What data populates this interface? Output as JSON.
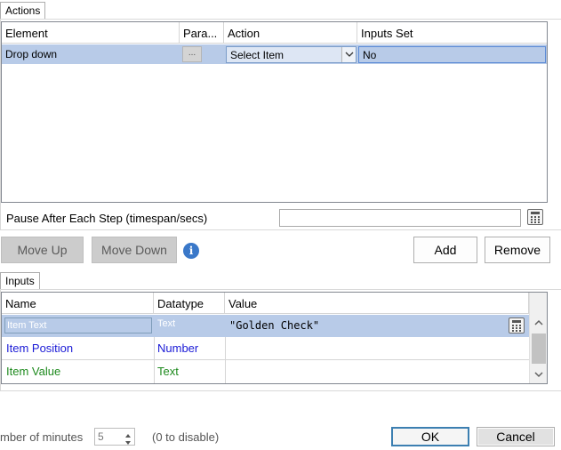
{
  "actions_tab": {
    "label": "Actions"
  },
  "actions_grid": {
    "columns": [
      "Element",
      "Para...",
      "Action",
      "Inputs Set"
    ],
    "rows": [
      {
        "element": "Drop down",
        "param_button": "...",
        "action": "Select Item",
        "inputs_set": "No"
      }
    ]
  },
  "pause": {
    "label": "Pause After Each Step (timespan/secs)",
    "value": ""
  },
  "buttons": {
    "move_up": "Move Up",
    "move_down": "Move Down",
    "add": "Add",
    "remove": "Remove",
    "ok": "OK",
    "cancel": "Cancel"
  },
  "inputs_tab": {
    "label": "Inputs"
  },
  "inputs_grid": {
    "columns": [
      "Name",
      "Datatype",
      "Value"
    ],
    "rows": [
      {
        "name": "Item Text",
        "datatype": "Text",
        "value": "\"Golden Check\"",
        "color": "#ffffff"
      },
      {
        "name": "Item Position",
        "datatype": "Number",
        "value": "",
        "color": "#1a1ad6"
      },
      {
        "name": "Item Value",
        "datatype": "Text",
        "value": "",
        "color": "#1e8a1e"
      }
    ]
  },
  "footer": {
    "minutes_label": "mber of minutes",
    "minutes_value": "5",
    "disable_hint": "(0 to disable)"
  },
  "colors": {
    "selection": "#b8cbe8",
    "info": "#3a78c9",
    "default_button_border": "#3c7fb1"
  }
}
